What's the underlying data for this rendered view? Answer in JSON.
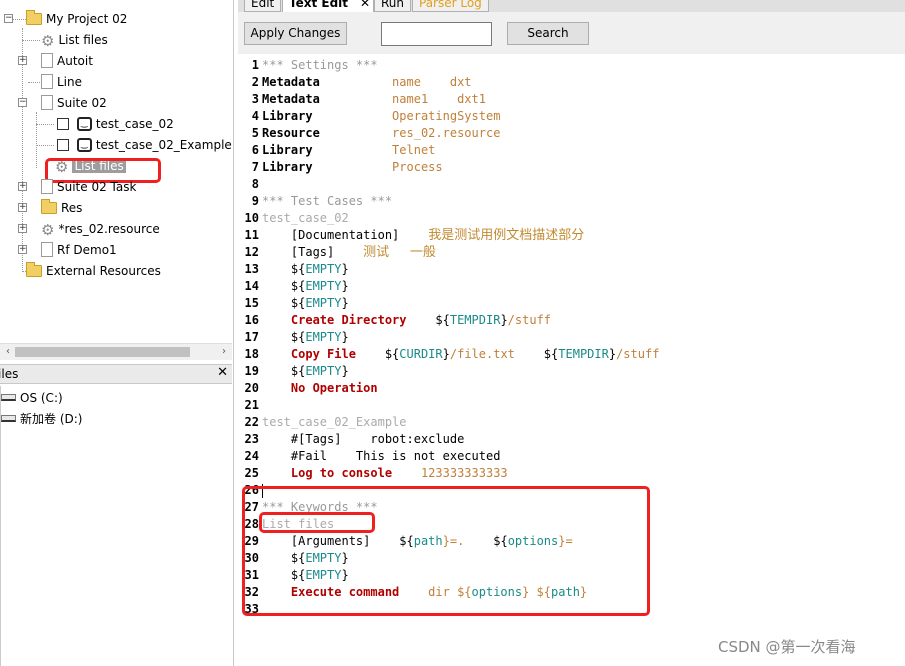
{
  "tree": {
    "project": "My Project 02",
    "list_files": "List files",
    "autoit": "Autoit",
    "line": "Line",
    "suite02": "Suite 02",
    "test_case_02": "test_case_02",
    "test_case_02_example": "test_case_02_Example",
    "list_files_selected": "List files",
    "suite02_task": "Suite 02 Task",
    "res": "Res",
    "res02_resource": "*res_02.resource",
    "rf_demo1": "Rf Demo1",
    "external_resources": "External Resources"
  },
  "files_panel": {
    "title": "Files",
    "close": "✕",
    "drives": [
      "OS (C:)",
      "新加卷 (D:)"
    ]
  },
  "tabs": [
    "Edit",
    "Text Edit",
    "Run",
    "Parser Log"
  ],
  "toolbar": {
    "apply_label": "Apply Changes",
    "search_label": "Search",
    "search_value": ""
  },
  "lines": [
    [
      [
        "*** Settings ***",
        "hdr"
      ]
    ],
    [
      [
        "Metadata",
        "set"
      ],
      [
        "          name    dxt",
        "val"
      ]
    ],
    [
      [
        "Metadata",
        "set"
      ],
      [
        "          name1    dxt1",
        "val"
      ]
    ],
    [
      [
        "Library",
        "set"
      ],
      [
        "           OperatingSystem",
        "val"
      ]
    ],
    [
      [
        "Resource",
        "set"
      ],
      [
        "          res_02.resource",
        "val"
      ]
    ],
    [
      [
        "Library",
        "set"
      ],
      [
        "           Telnet",
        "val"
      ]
    ],
    [
      [
        "Library",
        "set"
      ],
      [
        "           Process",
        "val"
      ]
    ],
    [],
    [
      [
        "*** Test Cases ***",
        "hdr"
      ]
    ],
    [
      [
        "test_case_02",
        "tc"
      ]
    ],
    [
      [
        "    [Documentation]",
        "txt"
      ],
      [
        "    ",
        "txt"
      ],
      [
        "我是测试用例文档描述部分",
        "cn"
      ]
    ],
    [
      [
        "    [Tags]",
        "txt"
      ],
      [
        "    ",
        "txt"
      ],
      [
        "测试     一般",
        "cn"
      ]
    ],
    [
      [
        "    ${",
        "txt"
      ],
      [
        "EMPTY",
        "var"
      ],
      [
        "}",
        "txt"
      ]
    ],
    [
      [
        "    ${",
        "txt"
      ],
      [
        "EMPTY",
        "var"
      ],
      [
        "}",
        "txt"
      ]
    ],
    [
      [
        "    ${",
        "txt"
      ],
      [
        "EMPTY",
        "var"
      ],
      [
        "}",
        "txt"
      ]
    ],
    [
      [
        "    Create Directory",
        "kw"
      ],
      [
        "    ${",
        "txt"
      ],
      [
        "TEMPDIR",
        "var"
      ],
      [
        "}",
        "txt"
      ],
      [
        "/stuff",
        "val"
      ]
    ],
    [
      [
        "    ${",
        "txt"
      ],
      [
        "EMPTY",
        "var"
      ],
      [
        "}",
        "txt"
      ]
    ],
    [
      [
        "    Copy File",
        "kw"
      ],
      [
        "    ${",
        "txt"
      ],
      [
        "CURDIR",
        "var"
      ],
      [
        "}",
        "txt"
      ],
      [
        "/file.txt",
        "val"
      ],
      [
        "    ${",
        "txt"
      ],
      [
        "TEMPDIR",
        "var"
      ],
      [
        "}",
        "txt"
      ],
      [
        "/stuff",
        "val"
      ]
    ],
    [
      [
        "    ${",
        "txt"
      ],
      [
        "EMPTY",
        "var"
      ],
      [
        "}",
        "txt"
      ]
    ],
    [
      [
        "    No Operation",
        "kw"
      ]
    ],
    [],
    [
      [
        "test_case_02_Example",
        "tc"
      ]
    ],
    [
      [
        "    #[Tags]",
        "txt"
      ],
      [
        "    robot:exclude",
        "txt"
      ]
    ],
    [
      [
        "    #Fail",
        "txt"
      ],
      [
        "    This is not executed",
        "txt"
      ]
    ],
    [
      [
        "    Log to console",
        "kw"
      ],
      [
        "    123333333333",
        "val"
      ]
    ],
    [],
    [
      [
        "*** Keywords ***",
        "hdr"
      ]
    ],
    [
      [
        "List files",
        "tc"
      ]
    ],
    [
      [
        "    [Arguments]",
        "txt"
      ],
      [
        "    ${",
        "txt"
      ],
      [
        "path",
        "var"
      ],
      [
        "}=.",
        "val"
      ],
      [
        "    ${",
        "txt"
      ],
      [
        "options",
        "var"
      ],
      [
        "}=",
        "val"
      ]
    ],
    [
      [
        "    ${",
        "txt"
      ],
      [
        "EMPTY",
        "var"
      ],
      [
        "}",
        "txt"
      ]
    ],
    [
      [
        "    ${",
        "txt"
      ],
      [
        "EMPTY",
        "var"
      ],
      [
        "}",
        "txt"
      ]
    ],
    [
      [
        "    Execute command",
        "kw"
      ],
      [
        "    dir ${",
        "val"
      ],
      [
        "options",
        "var"
      ],
      [
        "} ${",
        "val"
      ],
      [
        "path",
        "var"
      ],
      [
        "}",
        "val"
      ]
    ],
    []
  ],
  "watermark": "CSDN @第一次看海"
}
